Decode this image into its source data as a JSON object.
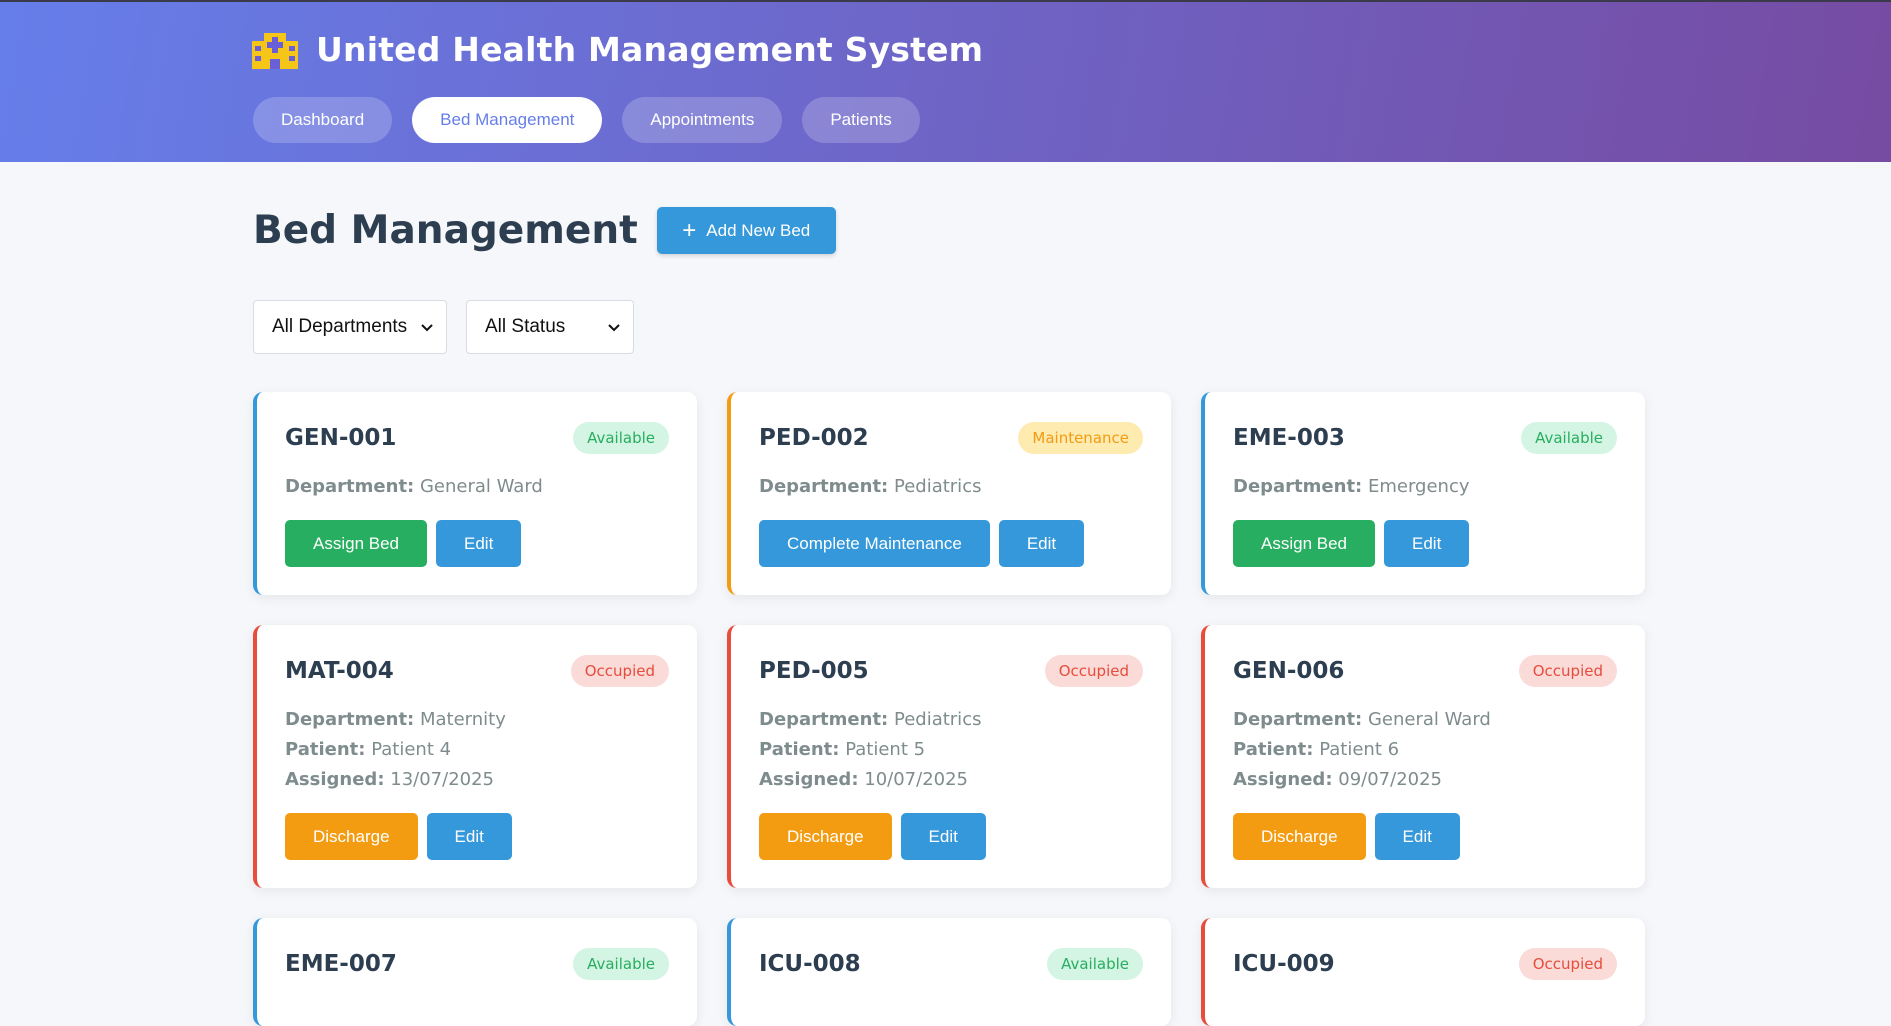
{
  "header": {
    "title": "United Health Management System",
    "icon": "hospital-icon",
    "nav": [
      {
        "label": "Dashboard",
        "active": false
      },
      {
        "label": "Bed Management",
        "active": true
      },
      {
        "label": "Appointments",
        "active": false
      },
      {
        "label": "Patients",
        "active": false
      }
    ]
  },
  "main": {
    "title": "Bed Management",
    "add_button": "Add New Bed",
    "filters": {
      "department": "All Departments",
      "status": "All Status"
    },
    "labels": {
      "department": "Department:",
      "patient": "Patient:",
      "assigned": "Assigned:"
    },
    "beds": [
      {
        "id": "GEN-001",
        "status": "Available",
        "department": "General Ward",
        "primary_action": "Assign Bed",
        "edit": "Edit"
      },
      {
        "id": "PED-002",
        "status": "Maintenance",
        "department": "Pediatrics",
        "primary_action": "Complete Maintenance",
        "edit": "Edit"
      },
      {
        "id": "EME-003",
        "status": "Available",
        "department": "Emergency",
        "primary_action": "Assign Bed",
        "edit": "Edit"
      },
      {
        "id": "MAT-004",
        "status": "Occupied",
        "department": "Maternity",
        "patient": "Patient 4",
        "assigned": "13/07/2025",
        "primary_action": "Discharge",
        "edit": "Edit"
      },
      {
        "id": "PED-005",
        "status": "Occupied",
        "department": "Pediatrics",
        "patient": "Patient 5",
        "assigned": "10/07/2025",
        "primary_action": "Discharge",
        "edit": "Edit"
      },
      {
        "id": "GEN-006",
        "status": "Occupied",
        "department": "General Ward",
        "patient": "Patient 6",
        "assigned": "09/07/2025",
        "primary_action": "Discharge",
        "edit": "Edit"
      },
      {
        "id": "EME-007",
        "status": "Available"
      },
      {
        "id": "ICU-008",
        "status": "Available"
      },
      {
        "id": "ICU-009",
        "status": "Occupied"
      }
    ]
  },
  "colors": {
    "header_gradient_start": "#667eea",
    "header_gradient_end": "#764ba2",
    "available": "#27ae60",
    "occupied": "#e74c3c",
    "maintenance": "#f39c12",
    "primary": "#3498db"
  }
}
